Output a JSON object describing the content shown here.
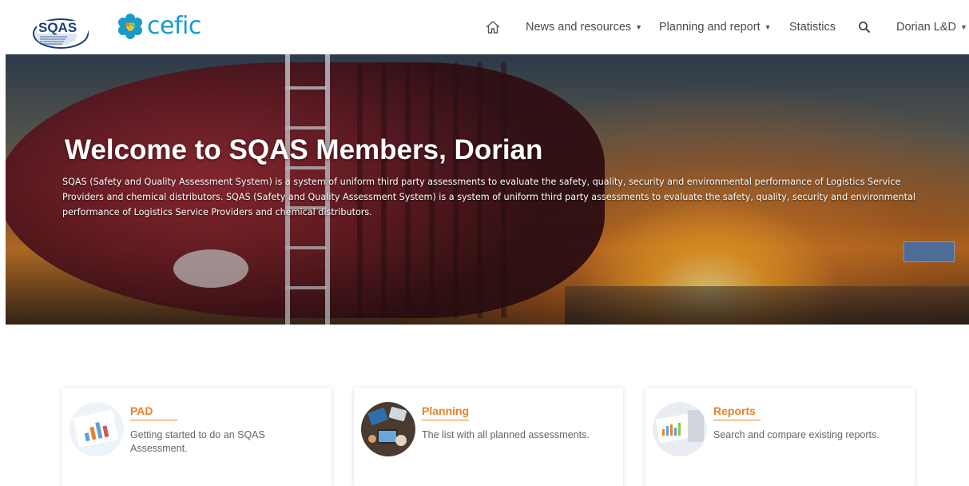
{
  "header": {
    "sqas_logo_text": "SQAS",
    "sqas_logo_tagline": "Safety and Quality Assessment for Sustainability",
    "cefic_logo_text": "cefic",
    "nav": {
      "home_icon": "home-icon",
      "news_label": "News and resources",
      "planning_label": "Planning and report",
      "statistics_label": "Statistics",
      "search_icon": "search-icon",
      "user_label": "Dorian L&D"
    }
  },
  "hero": {
    "title": "Welcome to SQAS Members, Dorian",
    "description": "SQAS (Safety and Quality Assessment System) is a system of uniform third party assessments to evaluate the safety, quality, security and environmental performance of Logistics Service Providers and chemical distributors. SQAS (Safety and Quality Assessment System) is a system of uniform third party assessments to evaluate the safety, quality, security and environmental performance of Logistics Service Providers and chemical distributors."
  },
  "cards": [
    {
      "title": "PAD",
      "description": "Getting started to do an SQAS Assessment."
    },
    {
      "title": "Planning",
      "description": "The list with all planned assessments."
    },
    {
      "title": "Reports",
      "description": "Search and compare existing reports."
    }
  ],
  "colors": {
    "accent": "#e8822a",
    "cefic_blue": "#1a9ac9",
    "sqas_navy": "#1b3f7a",
    "nav_text": "#4a4a4a"
  }
}
